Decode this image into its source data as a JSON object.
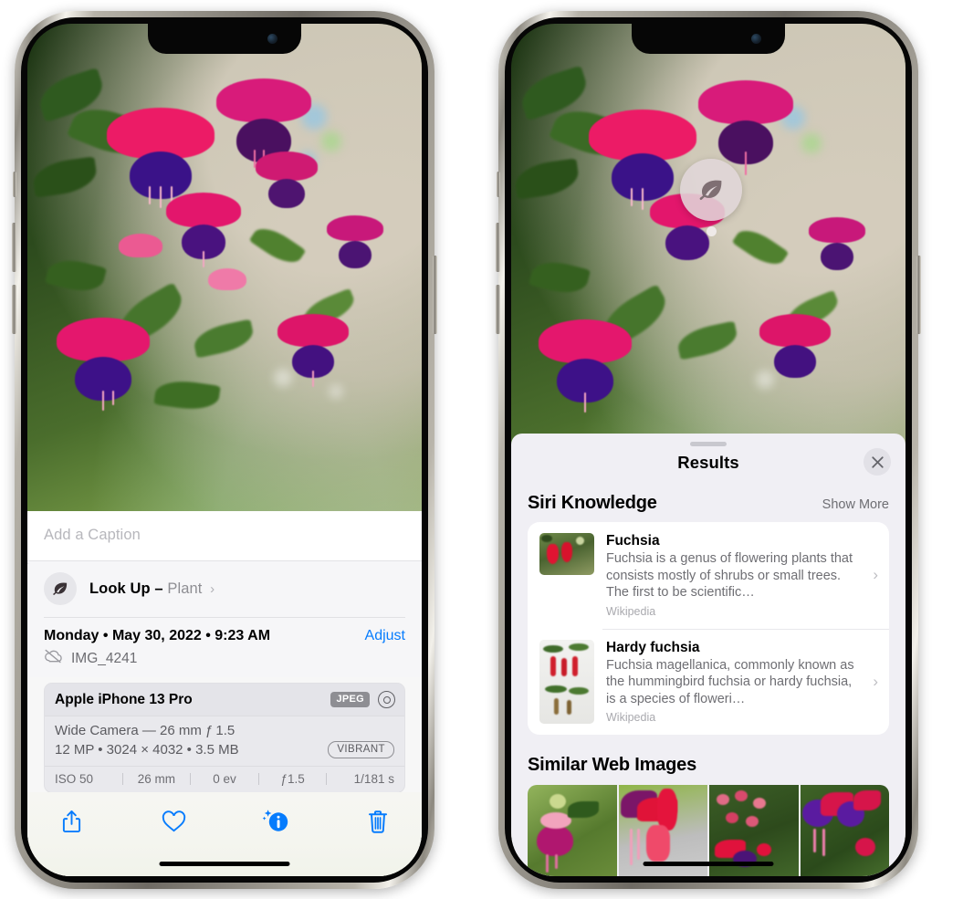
{
  "left_phone": {
    "name": "photos-detail-view",
    "photo": {
      "alt": "fuchsia flowers hanging basket"
    },
    "caption_field": {
      "placeholder": "Add a Caption",
      "value": ""
    },
    "lookup_row": {
      "icon": "leaf-icon",
      "sparkle_icon": "sparkle-icon",
      "label": "Look Up",
      "dash": "–",
      "subject": "Plant",
      "chevron": "›"
    },
    "metadata": {
      "date_line": "Monday • May 30, 2022 • 9:23 AM",
      "adjust_label": "Adjust",
      "cloud_icon": "cloud-slash-icon",
      "filename": "IMG_4241"
    },
    "exif": {
      "device": "Apple iPhone 13 Pro",
      "format_chip": "JPEG",
      "raw_icon": "aperture-icon",
      "lens": "Wide Camera — 26 mm ƒ 1.5",
      "size_line": "12 MP • 3024 × 4032 • 3.5 MB",
      "style_chip": "VIBRANT",
      "stats": [
        "ISO 50",
        "26 mm",
        "0 ev",
        "ƒ1.5",
        "1/181 s"
      ]
    },
    "map": {
      "pin_label": "photo-location-pin"
    },
    "toolbar": [
      {
        "name": "share-button",
        "icon": "share-icon"
      },
      {
        "name": "favorite-button",
        "icon": "heart-icon"
      },
      {
        "name": "info-button",
        "icon": "info-sparkle-icon"
      },
      {
        "name": "delete-button",
        "icon": "trash-icon"
      }
    ],
    "accent_color": "#067cfd"
  },
  "right_phone": {
    "name": "visual-lookup-results-view",
    "photo_badge": {
      "icon": "leaf-icon",
      "label": "visual-lookup-leaf-badge"
    },
    "sheet": {
      "grabber": "drag-handle",
      "title": "Results",
      "close_icon": "close-icon"
    },
    "siri_knowledge": {
      "title": "Siri Knowledge",
      "show_more": "Show More",
      "cards": [
        {
          "title": "Fuchsia",
          "description": "Fuchsia is a genus of flowering plants that consists mostly of shrubs or small trees. The first to be scientific…",
          "source": "Wikipedia",
          "chevron": "›",
          "thumb": "fuchsia-wide-thumbnail"
        },
        {
          "title": "Hardy fuchsia",
          "description": "Fuchsia magellanica, commonly known as the hummingbird fuchsia or hardy fuchsia, is a species of floweri…",
          "source": "Wikipedia",
          "chevron": "›",
          "thumb": "hardy-fuchsia-tall-thumbnail"
        }
      ]
    },
    "similar_web_images": {
      "title": "Similar Web Images",
      "images": [
        "similar-image-1",
        "similar-image-2",
        "similar-image-3",
        "similar-image-4"
      ]
    }
  }
}
